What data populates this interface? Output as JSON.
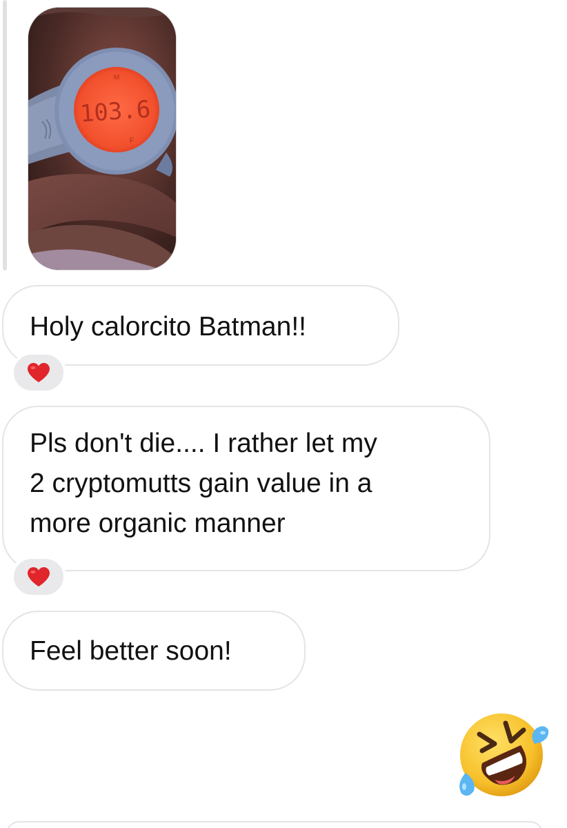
{
  "conversation": {
    "photo": {
      "thermometer_display": "103.6",
      "mode_indicator": "M",
      "unit_indicator": "F"
    },
    "messages": [
      {
        "text": "Holy calorcito Batman!!",
        "reaction": "red-heart"
      },
      {
        "text": "Pls don't die.... I rather let my\n2 cryptomutts gain value in a\nmore organic manner",
        "reaction": "red-heart"
      },
      {
        "text": "Feel better soon!"
      }
    ],
    "sent_emoji": "rolling-on-the-floor-laughing"
  },
  "colors": {
    "bubble_border": "#e4e4e6",
    "reaction_bg": "#e9e9eb",
    "heart": "#e0252b",
    "thermometer_screen": "#f2502d"
  }
}
